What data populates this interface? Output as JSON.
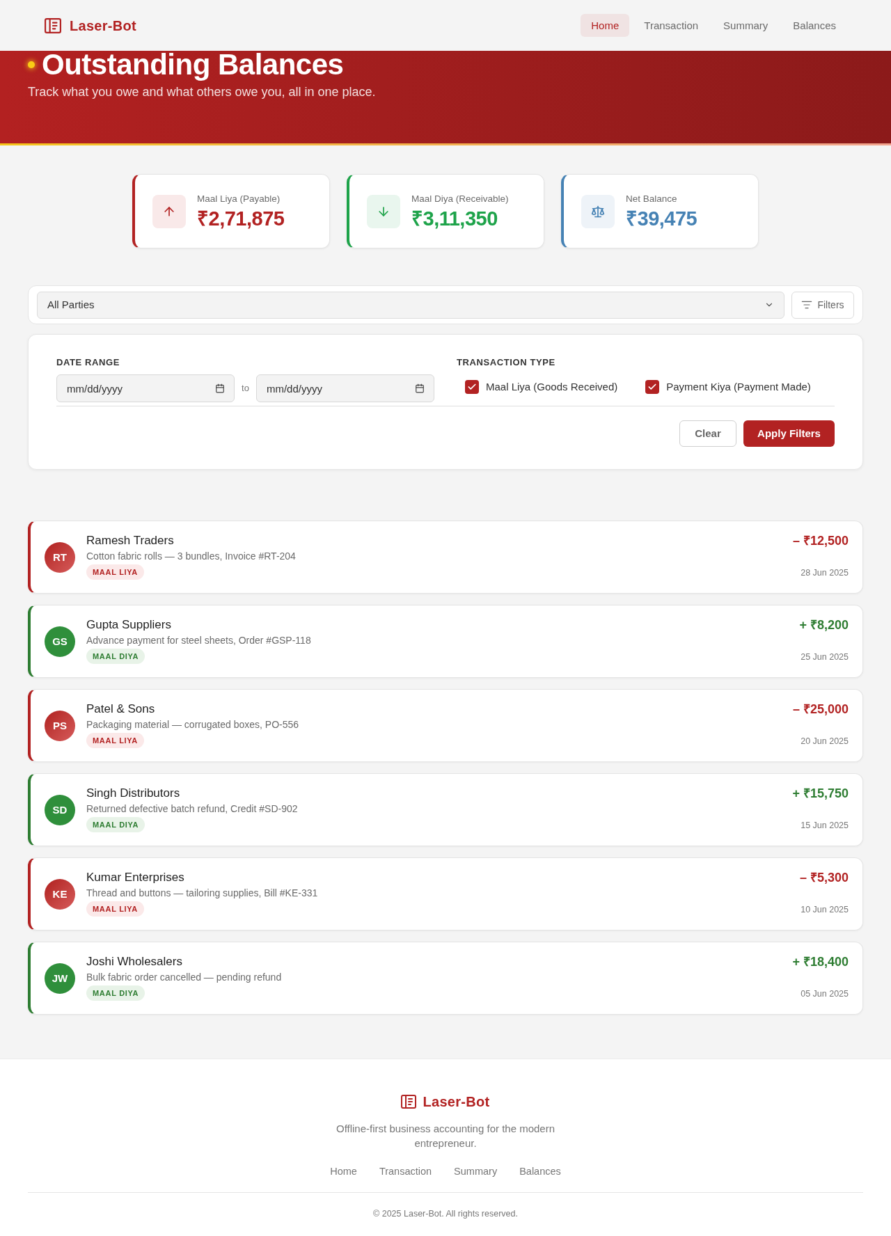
{
  "header": {
    "brand": "Laser-Bot",
    "nav": [
      {
        "label": "Home",
        "selected": true
      },
      {
        "label": "Transaction",
        "selected": false
      },
      {
        "label": "Summary",
        "selected": false
      },
      {
        "label": "Balances",
        "selected": false
      }
    ]
  },
  "hero": {
    "title": "Outstanding Balances",
    "subtitle": "Track what you owe and what others owe you, all in one place."
  },
  "summary_cards": [
    {
      "kind": "payable",
      "label": "Maal Liya (Payable)",
      "value": "₹2,71,875"
    },
    {
      "kind": "receivable",
      "label": "Maal Diya (Receivable)",
      "value": "₹3,11,350"
    },
    {
      "kind": "net",
      "label": "Net Balance",
      "value": "₹39,475"
    }
  ],
  "party_filter": {
    "value": "All Parties",
    "button": "Filters"
  },
  "filter_panel": {
    "date_range": {
      "label": "DATE RANGE",
      "from": {
        "placeholder": "mm/dd/yyyy"
      },
      "separator": "to",
      "to": {
        "placeholder": "mm/dd/yyyy"
      }
    },
    "transaction_type": {
      "label": "TRANSACTION TYPE",
      "options": [
        {
          "label": "Maal Liya (Goods Received)",
          "checked": true
        },
        {
          "label": "Payment Kiya (Payment Made)",
          "checked": true
        }
      ]
    },
    "buttons": {
      "clear": "Clear",
      "apply": "Apply Filters"
    }
  },
  "entries": [
    {
      "kind": "payable",
      "initials": "RT",
      "name": "Ramesh Traders",
      "description": "Cotton fabric rolls — 3 bundles, Invoice #RT-204",
      "tag": "MAAL LIYA",
      "amount": "– ₹12,500",
      "date": "28 Jun 2025"
    },
    {
      "kind": "receivable",
      "initials": "GS",
      "name": "Gupta Suppliers",
      "description": "Advance payment for steel sheets, Order #GSP-118",
      "tag": "MAAL DIYA",
      "amount": "+ ₹8,200",
      "date": "25 Jun 2025"
    },
    {
      "kind": "payable",
      "initials": "PS",
      "name": "Patel & Sons",
      "description": "Packaging material — corrugated boxes, PO-556",
      "tag": "MAAL LIYA",
      "amount": "– ₹25,000",
      "date": "20 Jun 2025"
    },
    {
      "kind": "receivable",
      "initials": "SD",
      "name": "Singh Distributors",
      "description": "Returned defective batch refund, Credit #SD-902",
      "tag": "MAAL DIYA",
      "amount": "+ ₹15,750",
      "date": "15 Jun 2025"
    },
    {
      "kind": "payable",
      "initials": "KE",
      "name": "Kumar Enterprises",
      "description": "Thread and buttons — tailoring supplies, Bill #KE-331",
      "tag": "MAAL LIYA",
      "amount": "– ₹5,300",
      "date": "10 Jun 2025"
    },
    {
      "kind": "receivable",
      "initials": "JW",
      "name": "Joshi Wholesalers",
      "description": "Bulk fabric order cancelled — pending refund",
      "tag": "MAAL DIYA",
      "amount": "+ ₹18,400",
      "date": "05 Jun 2025"
    }
  ],
  "footer": {
    "brand": "Laser-Bot",
    "tagline": "Offline-first business accounting for the modern entrepreneur.",
    "links": [
      "Home",
      "Transaction",
      "Summary",
      "Balances"
    ],
    "copyright": "© 2025 Laser-Bot. All rights reserved."
  }
}
